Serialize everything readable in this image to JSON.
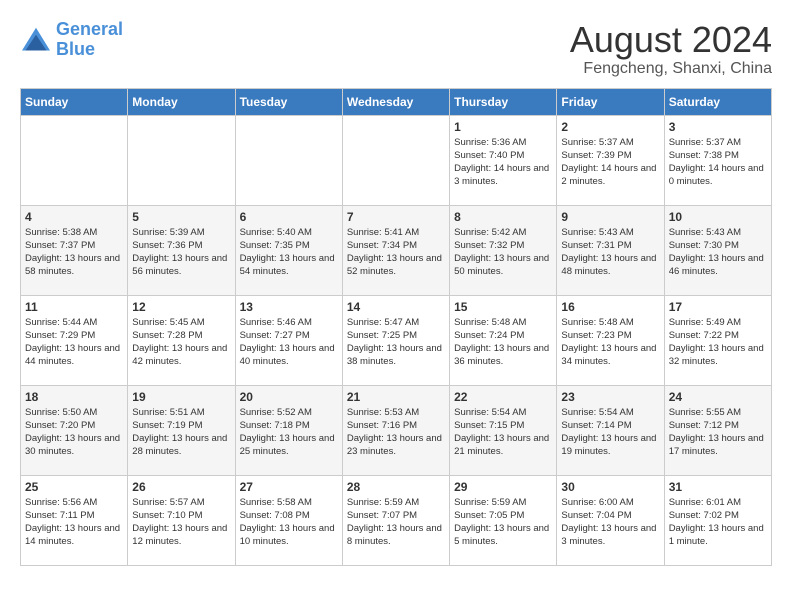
{
  "header": {
    "logo_line1": "General",
    "logo_line2": "Blue",
    "month_year": "August 2024",
    "location": "Fengcheng, Shanxi, China"
  },
  "weekdays": [
    "Sunday",
    "Monday",
    "Tuesday",
    "Wednesday",
    "Thursday",
    "Friday",
    "Saturday"
  ],
  "weeks": [
    [
      {
        "day": "",
        "info": ""
      },
      {
        "day": "",
        "info": ""
      },
      {
        "day": "",
        "info": ""
      },
      {
        "day": "",
        "info": ""
      },
      {
        "day": "1",
        "info": "Sunrise: 5:36 AM\nSunset: 7:40 PM\nDaylight: 14 hours\nand 3 minutes."
      },
      {
        "day": "2",
        "info": "Sunrise: 5:37 AM\nSunset: 7:39 PM\nDaylight: 14 hours\nand 2 minutes."
      },
      {
        "day": "3",
        "info": "Sunrise: 5:37 AM\nSunset: 7:38 PM\nDaylight: 14 hours\nand 0 minutes."
      }
    ],
    [
      {
        "day": "4",
        "info": "Sunrise: 5:38 AM\nSunset: 7:37 PM\nDaylight: 13 hours\nand 58 minutes."
      },
      {
        "day": "5",
        "info": "Sunrise: 5:39 AM\nSunset: 7:36 PM\nDaylight: 13 hours\nand 56 minutes."
      },
      {
        "day": "6",
        "info": "Sunrise: 5:40 AM\nSunset: 7:35 PM\nDaylight: 13 hours\nand 54 minutes."
      },
      {
        "day": "7",
        "info": "Sunrise: 5:41 AM\nSunset: 7:34 PM\nDaylight: 13 hours\nand 52 minutes."
      },
      {
        "day": "8",
        "info": "Sunrise: 5:42 AM\nSunset: 7:32 PM\nDaylight: 13 hours\nand 50 minutes."
      },
      {
        "day": "9",
        "info": "Sunrise: 5:43 AM\nSunset: 7:31 PM\nDaylight: 13 hours\nand 48 minutes."
      },
      {
        "day": "10",
        "info": "Sunrise: 5:43 AM\nSunset: 7:30 PM\nDaylight: 13 hours\nand 46 minutes."
      }
    ],
    [
      {
        "day": "11",
        "info": "Sunrise: 5:44 AM\nSunset: 7:29 PM\nDaylight: 13 hours\nand 44 minutes."
      },
      {
        "day": "12",
        "info": "Sunrise: 5:45 AM\nSunset: 7:28 PM\nDaylight: 13 hours\nand 42 minutes."
      },
      {
        "day": "13",
        "info": "Sunrise: 5:46 AM\nSunset: 7:27 PM\nDaylight: 13 hours\nand 40 minutes."
      },
      {
        "day": "14",
        "info": "Sunrise: 5:47 AM\nSunset: 7:25 PM\nDaylight: 13 hours\nand 38 minutes."
      },
      {
        "day": "15",
        "info": "Sunrise: 5:48 AM\nSunset: 7:24 PM\nDaylight: 13 hours\nand 36 minutes."
      },
      {
        "day": "16",
        "info": "Sunrise: 5:48 AM\nSunset: 7:23 PM\nDaylight: 13 hours\nand 34 minutes."
      },
      {
        "day": "17",
        "info": "Sunrise: 5:49 AM\nSunset: 7:22 PM\nDaylight: 13 hours\nand 32 minutes."
      }
    ],
    [
      {
        "day": "18",
        "info": "Sunrise: 5:50 AM\nSunset: 7:20 PM\nDaylight: 13 hours\nand 30 minutes."
      },
      {
        "day": "19",
        "info": "Sunrise: 5:51 AM\nSunset: 7:19 PM\nDaylight: 13 hours\nand 28 minutes."
      },
      {
        "day": "20",
        "info": "Sunrise: 5:52 AM\nSunset: 7:18 PM\nDaylight: 13 hours\nand 25 minutes."
      },
      {
        "day": "21",
        "info": "Sunrise: 5:53 AM\nSunset: 7:16 PM\nDaylight: 13 hours\nand 23 minutes."
      },
      {
        "day": "22",
        "info": "Sunrise: 5:54 AM\nSunset: 7:15 PM\nDaylight: 13 hours\nand 21 minutes."
      },
      {
        "day": "23",
        "info": "Sunrise: 5:54 AM\nSunset: 7:14 PM\nDaylight: 13 hours\nand 19 minutes."
      },
      {
        "day": "24",
        "info": "Sunrise: 5:55 AM\nSunset: 7:12 PM\nDaylight: 13 hours\nand 17 minutes."
      }
    ],
    [
      {
        "day": "25",
        "info": "Sunrise: 5:56 AM\nSunset: 7:11 PM\nDaylight: 13 hours\nand 14 minutes."
      },
      {
        "day": "26",
        "info": "Sunrise: 5:57 AM\nSunset: 7:10 PM\nDaylight: 13 hours\nand 12 minutes."
      },
      {
        "day": "27",
        "info": "Sunrise: 5:58 AM\nSunset: 7:08 PM\nDaylight: 13 hours\nand 10 minutes."
      },
      {
        "day": "28",
        "info": "Sunrise: 5:59 AM\nSunset: 7:07 PM\nDaylight: 13 hours\nand 8 minutes."
      },
      {
        "day": "29",
        "info": "Sunrise: 5:59 AM\nSunset: 7:05 PM\nDaylight: 13 hours\nand 5 minutes."
      },
      {
        "day": "30",
        "info": "Sunrise: 6:00 AM\nSunset: 7:04 PM\nDaylight: 13 hours\nand 3 minutes."
      },
      {
        "day": "31",
        "info": "Sunrise: 6:01 AM\nSunset: 7:02 PM\nDaylight: 13 hours\nand 1 minute."
      }
    ]
  ]
}
